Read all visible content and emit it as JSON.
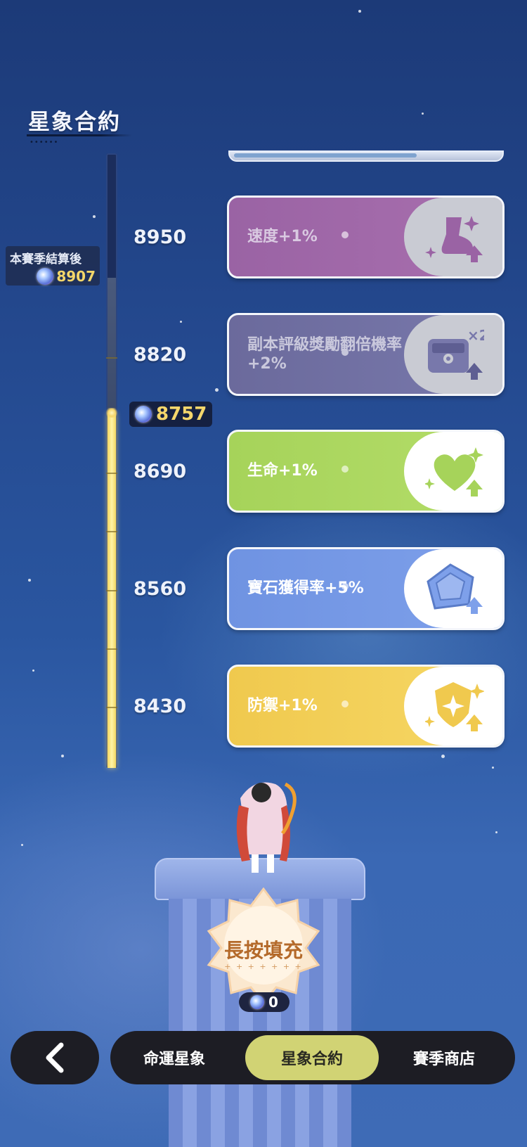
{
  "page": {
    "title": "星象合約"
  },
  "season": {
    "label": "本賽季結算後",
    "value": "8907",
    "icon": "star-gem-icon"
  },
  "current": {
    "value": "8757",
    "icon": "star-gem-icon"
  },
  "progress": {
    "current": 8757,
    "season_end": 8907
  },
  "milestones": [
    {
      "value": "8950",
      "reward": "速度+1%",
      "icon": "boot-icon",
      "color": "#a86fae",
      "unlocked": false
    },
    {
      "value": "8820",
      "reward": "副本評級獎勵翻倍機率+2%",
      "icon": "treasure-chest-x2-icon",
      "badge": "×2",
      "color": "#7878ab",
      "unlocked": false
    },
    {
      "value": "8690",
      "reward": "生命+1%",
      "icon": "heart-icon",
      "color": "#b4dd69",
      "unlocked": true
    },
    {
      "value": "8560",
      "reward": "寶石獲得率+5%",
      "icon": "gem-icon",
      "color": "#7ea0ea",
      "unlocked": true
    },
    {
      "value": "8430",
      "reward": "防禦+1%",
      "icon": "shield-icon",
      "color": "#f6d866",
      "unlocked": true
    }
  ],
  "fill": {
    "label": "長按填充",
    "count": "0"
  },
  "nav": {
    "back_icon": "chevron-left-icon",
    "tabs": [
      {
        "label": "命運星象",
        "active": false
      },
      {
        "label": "星象合約",
        "active": true
      },
      {
        "label": "賽季商店",
        "active": false
      }
    ]
  },
  "colors": {
    "accent": "#d1d374",
    "gold": "#f5d66b",
    "background": "#24498f"
  }
}
